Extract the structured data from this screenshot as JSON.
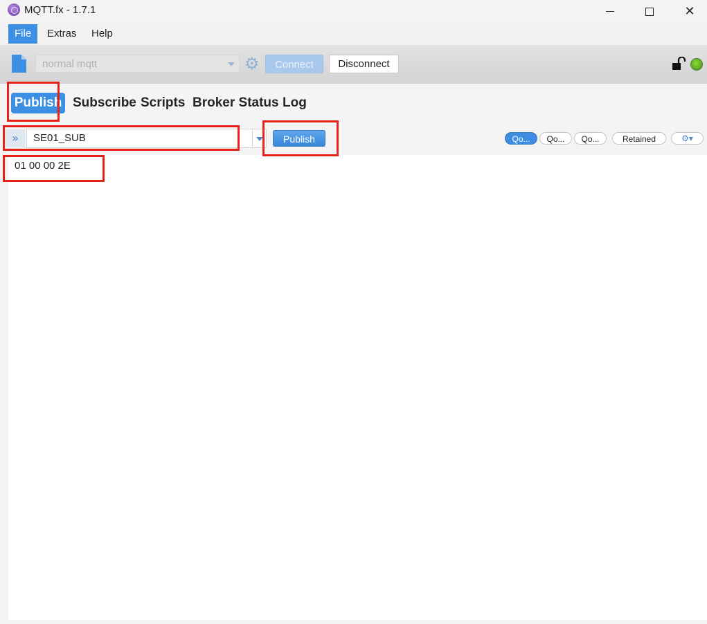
{
  "window": {
    "title": "MQTT.fx - 1.7.1",
    "app_icon": "mqttfx-logo-icon",
    "controls": {
      "minimize": "minimize-icon",
      "maximize": "maximize-icon",
      "close": "close-icon",
      "close_glyph": "✕"
    }
  },
  "menu": {
    "items": [
      {
        "label": "File",
        "active": true
      },
      {
        "label": "Extras",
        "active": false
      },
      {
        "label": "Help",
        "active": false
      }
    ]
  },
  "toolbar": {
    "profile": {
      "value": "normal mqtt"
    },
    "settings_glyph": "⚙",
    "connect_label": "Connect",
    "connect_enabled": false,
    "disconnect_label": "Disconnect",
    "connection_status_color": "#5cb82a"
  },
  "tabs": [
    {
      "label": "Publish",
      "active": true
    },
    {
      "label": "Subscribe",
      "active": false
    },
    {
      "label": "Scripts",
      "active": false
    },
    {
      "label": "Broker Status",
      "active": false
    },
    {
      "label": "Log",
      "active": false
    }
  ],
  "publish": {
    "expand_glyph": "»",
    "topic": "SE01_SUB",
    "publish_label": "Publish",
    "qos": [
      {
        "label": "Qo...",
        "selected": true
      },
      {
        "label": "Qo...",
        "selected": false
      },
      {
        "label": "Qo...",
        "selected": false
      }
    ],
    "retained_label": "Retained",
    "options_glyph": "⚙▾",
    "payload": "01 00 00 2E"
  },
  "colors": {
    "accent": "#3d8fe3",
    "highlight": "#e8201a"
  }
}
